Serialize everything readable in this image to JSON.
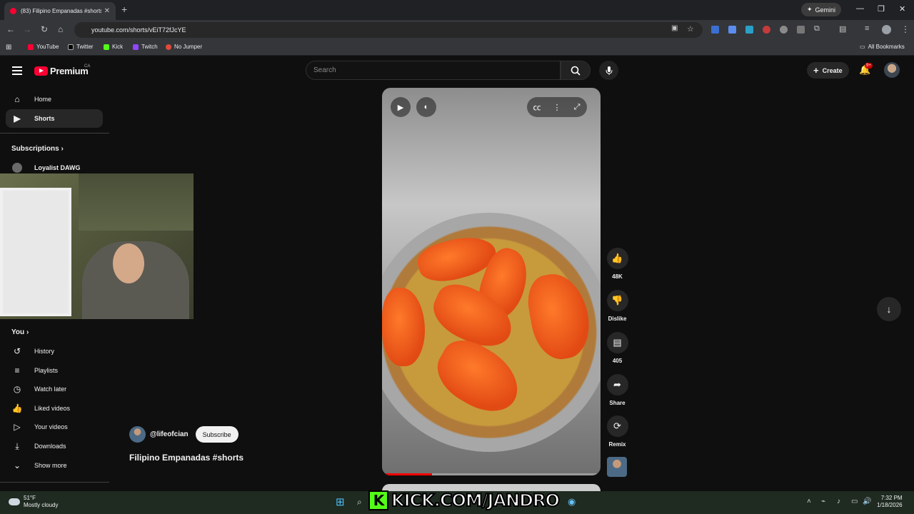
{
  "browser": {
    "tab_title": "(83) Filipino Empanadas #shorts",
    "url": "youtube.com/shorts/vEiT72fJcYE",
    "gemini_label": "Gemini",
    "bookmarks": [
      "YouTube",
      "Twitter",
      "Kick",
      "Twitch",
      "No Jumper"
    ],
    "all_bookmarks": "All Bookmarks"
  },
  "header": {
    "logo": "Premium",
    "region": "CA",
    "search_placeholder": "Search",
    "create_label": "Create",
    "notif_badge": "9+"
  },
  "sidebar": {
    "items": [
      {
        "label": "Home",
        "icon": "home-icon"
      },
      {
        "label": "Shorts",
        "icon": "shorts-icon",
        "active": true
      }
    ],
    "subscriptions_title": "Subscriptions",
    "subscription": "Loyalist DAWG",
    "you_title": "You",
    "you_items": [
      {
        "label": "History",
        "icon": "history-icon"
      },
      {
        "label": "Playlists",
        "icon": "playlists-icon"
      },
      {
        "label": "Watch later",
        "icon": "clock-icon"
      },
      {
        "label": "Liked videos",
        "icon": "thumb-up-icon"
      },
      {
        "label": "Your videos",
        "icon": "video-icon"
      },
      {
        "label": "Downloads",
        "icon": "download-icon"
      },
      {
        "label": "Show more",
        "icon": "chevron-down-icon"
      }
    ]
  },
  "short": {
    "channel": "@lifeofcian",
    "subscribe": "Subscribe",
    "title": "Filipino Empanadas #shorts",
    "progress": 0.23
  },
  "actions": {
    "likes": "48K",
    "dislike": "Dislike",
    "comments": "405",
    "share": "Share",
    "remix": "Remix"
  },
  "taskbar": {
    "temp": "51°F",
    "weather": "Mostly cloudy",
    "overlay": "KICK.COM/JANDRO",
    "time": "7:32 PM",
    "date": "1/18/2026"
  },
  "colors": {
    "accent": "#ff0033",
    "kick": "#53fc18"
  }
}
